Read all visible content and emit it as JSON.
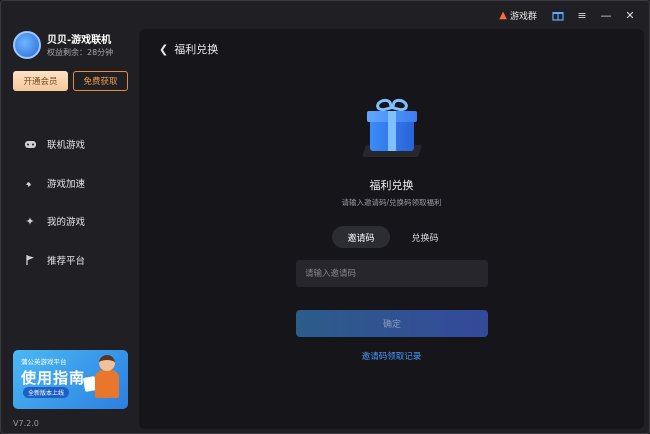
{
  "titlebar": {
    "group_label": "游戏群",
    "group_icon": "fire-icon",
    "gift_icon": "gift-icon",
    "menu_icon": "menu-icon",
    "minimize_icon": "minimize-icon",
    "close_icon": "close-icon",
    "gift_color": "#5aa8ff"
  },
  "user": {
    "name": "贝贝-游戏联机",
    "quota": "权益剩余：28分钟",
    "vip_button": "开通会员",
    "free_button": "免费获取"
  },
  "sidebar": {
    "items": [
      {
        "label": "联机游戏",
        "icon": "gamepad-icon"
      },
      {
        "label": "游戏加速",
        "icon": "rocket-icon"
      },
      {
        "label": "我的游戏",
        "icon": "sparkle-icon"
      },
      {
        "label": "推荐平台",
        "icon": "flag-icon"
      }
    ],
    "banner": {
      "small_text": "蒲公英游戏平台",
      "title": "使用指南",
      "tag": "全新版本上线"
    },
    "version": "V7.2.0"
  },
  "main": {
    "back_label": "福利兑换",
    "title": "福利兑换",
    "subtitle": "请输入邀请码/兑换码领取福利",
    "tabs": [
      {
        "label": "邀请码",
        "active": true
      },
      {
        "label": "兑换码",
        "active": false
      }
    ],
    "input_placeholder": "请输入邀请码",
    "input_value": "",
    "confirm_label": "确定",
    "record_link": "邀请码领取记录",
    "accent_color": "#4a9bff"
  }
}
